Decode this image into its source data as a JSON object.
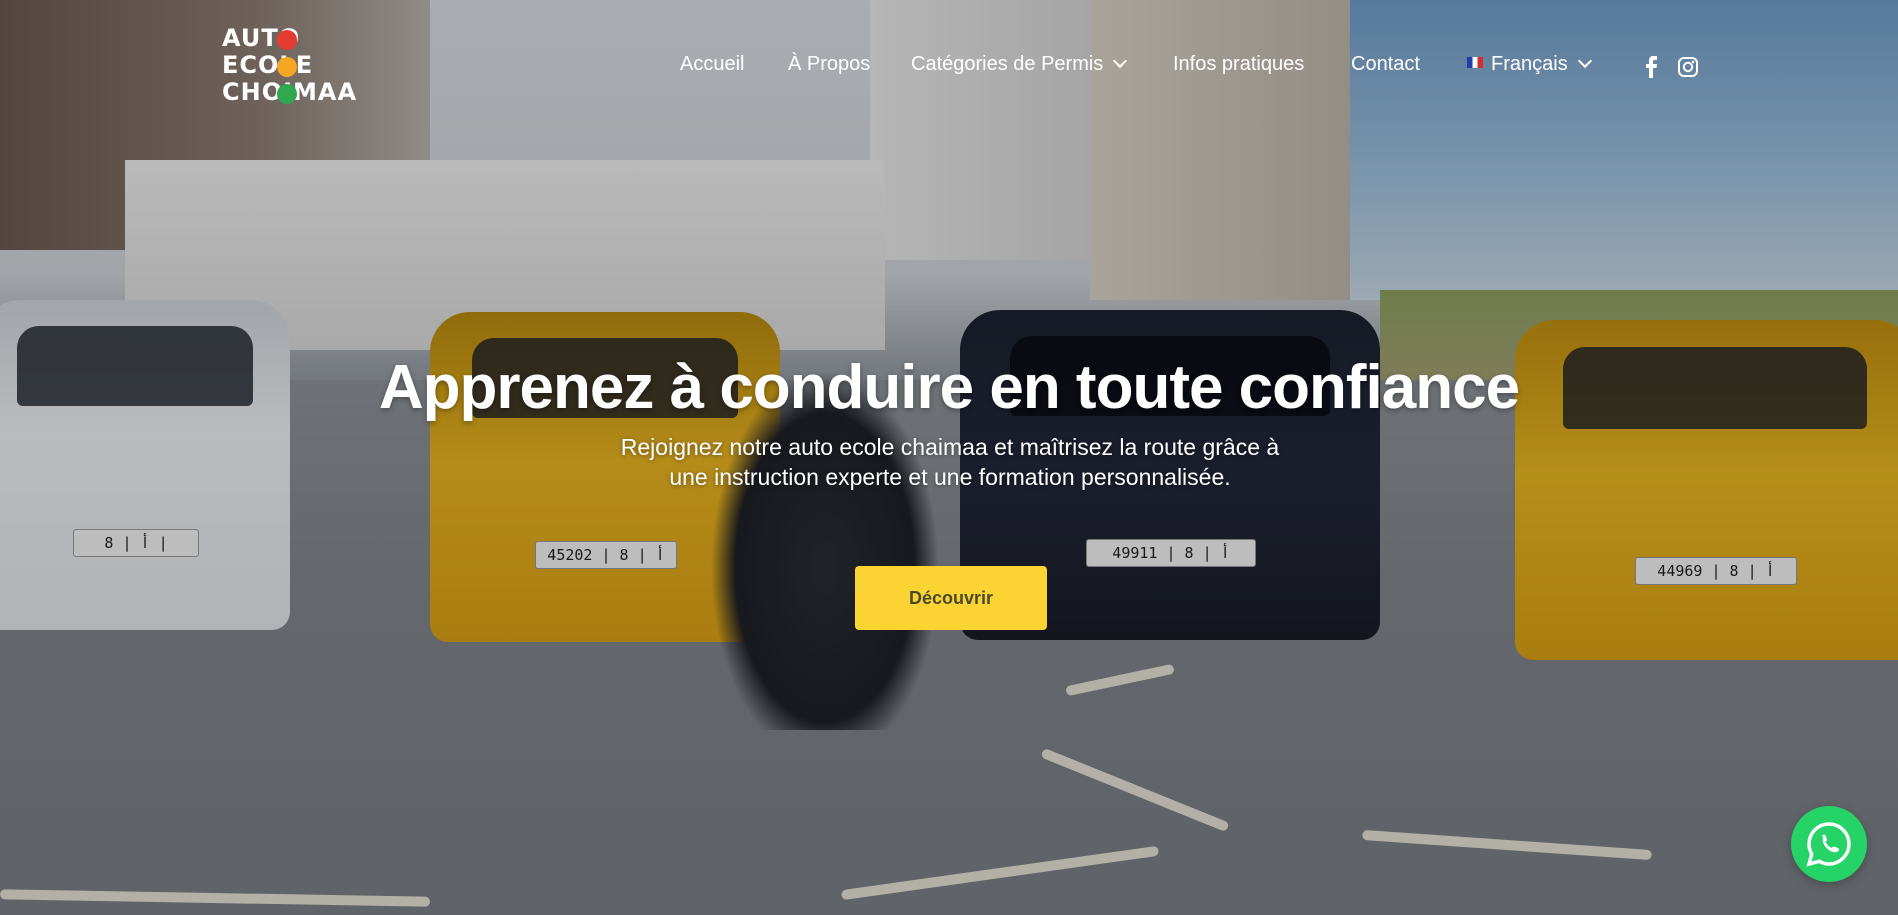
{
  "brand": {
    "logo_lines": [
      "AUTO",
      "ECOLE",
      "CHOIMAA"
    ],
    "logo_dot_colors": [
      "#e53a2f",
      "#f5a623",
      "#2fa84f"
    ]
  },
  "nav": {
    "items": [
      {
        "label": "Accueil"
      },
      {
        "label": "À Propos"
      },
      {
        "label": "Catégories de Permis",
        "has_dropdown": true
      },
      {
        "label": "Infos pratiques"
      },
      {
        "label": "Contact"
      }
    ],
    "language": {
      "label": "Français",
      "flag_icon": "france-flag-icon",
      "has_dropdown": true
    },
    "social": [
      {
        "icon": "facebook-icon"
      },
      {
        "icon": "instagram-icon"
      }
    ]
  },
  "hero": {
    "headline": "Apprenez à conduire en toute confiance",
    "subtext": "Rejoignez notre auto ecole chaimaa et maîtrisez la route grâce à une instruction experte et une formation personnalisée.",
    "cta_label": "Découvrir",
    "plates": [
      "45202 | أ | 8",
      "49911 | أ | 8",
      "44969 | أ | 8",
      "8 | أ |"
    ]
  },
  "floating": {
    "whatsapp_icon": "whatsapp-icon"
  },
  "colors": {
    "cta_background": "#fbd434",
    "whatsapp": "#25d366",
    "text": "#ffffff"
  }
}
